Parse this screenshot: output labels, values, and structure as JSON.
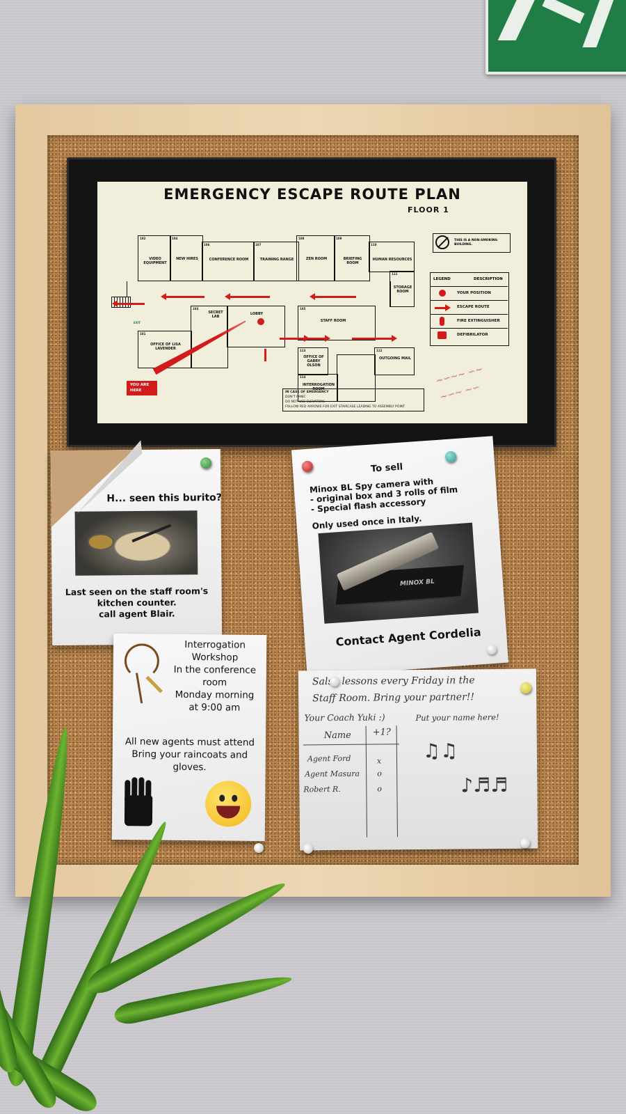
{
  "scene": {
    "type": "hidden-object puzzle scene",
    "board": "cork board with wooden frame",
    "wall_color": "#cbc8cd"
  },
  "map": {
    "title": "EMERGENCY ESCAPE ROUTE PLAN",
    "floor": "FLOOR 1",
    "no_smoking": "THIS IS A NON-SMOKING BUILDING.",
    "rooms": [
      {
        "num": "102",
        "label": "VIDEO EQUIPMENT"
      },
      {
        "num": "104",
        "label": "NEW HIRES"
      },
      {
        "num": "106",
        "label": "CONFERENCE ROOM"
      },
      {
        "num": "107",
        "label": "TRAINING RANGE"
      },
      {
        "num": "108",
        "label": "ZEN ROOM"
      },
      {
        "num": "109",
        "label": "BRIEFING ROOM"
      },
      {
        "num": "110",
        "label": "HUMAN RESOURCES"
      },
      {
        "num": "111",
        "label": "STORAGE ROOM"
      },
      {
        "num": "101",
        "label": "OFFICE OF LISA LAVENDER"
      },
      {
        "num": "103",
        "label": "SECRET LAB"
      },
      {
        "num": "",
        "label": "LOBBY"
      },
      {
        "num": "105",
        "label": "STAFF ROOM"
      },
      {
        "num": "113",
        "label": "OFFICE OF GARRY OLSON"
      },
      {
        "num": "112",
        "label": "OUTGOING MAIL"
      },
      {
        "num": "114",
        "label": "INTERROGATION ROOM"
      }
    ],
    "exit_label": "EXIT",
    "legend": {
      "head_left": "LEGEND",
      "head_right": "DESCRIPTION",
      "items": [
        "YOUR POSITION",
        "ESCAPE ROUTE",
        "FIRE EXTINGUISHER",
        "DEFIBRILATOR"
      ]
    },
    "you_are_here": "YOU ARE HERE",
    "emergency": {
      "heading": "IN CASE OF EMERGENCY",
      "lines": [
        "DON'T PANIC",
        "DO NOT USE ELEVATORS",
        "FOLLOW RED ARROWS FOR EXIT STAIRCASE LEADING TO ASSEMBLY POINT"
      ]
    },
    "accent_color": "#d21c1c"
  },
  "burito_note": {
    "title": "H... seen this burito?",
    "line1": "Last seen on the staff room's",
    "line2": "kitchen counter.",
    "line3": "call agent Blair."
  },
  "minox_note": {
    "heading": "To sell",
    "line1": "Minox BL Spy camera with",
    "line2": "- original box and 3 rolls of film",
    "line3": "- Special flash accessory",
    "line4": "Only used once in Italy.",
    "brand": "MINOX BL",
    "contact": "Contact Agent Cordelia"
  },
  "interrogation_note": {
    "l1": "Interrogation",
    "l2": "Workshop",
    "l3": "In the conference",
    "l4": "room",
    "l5": "Monday morning",
    "l6": "at 9:00 am",
    "l7": "All new agents must attend",
    "l8": "Bring your raincoats and",
    "l9": "gloves."
  },
  "salsa_note": {
    "l1": "Salsa lessons every Friday in the",
    "l2": "Staff Room. Bring your partner!!",
    "l3": "Your Coach Yuki :)",
    "l4": "Put your name here!",
    "col_name": "Name",
    "col_plus": "+1?",
    "rows": [
      {
        "name": "Agent Ford",
        "plus": "x"
      },
      {
        "name": "Agent Masura",
        "plus": "o"
      },
      {
        "name": "Robert R.",
        "plus": "o"
      }
    ]
  }
}
